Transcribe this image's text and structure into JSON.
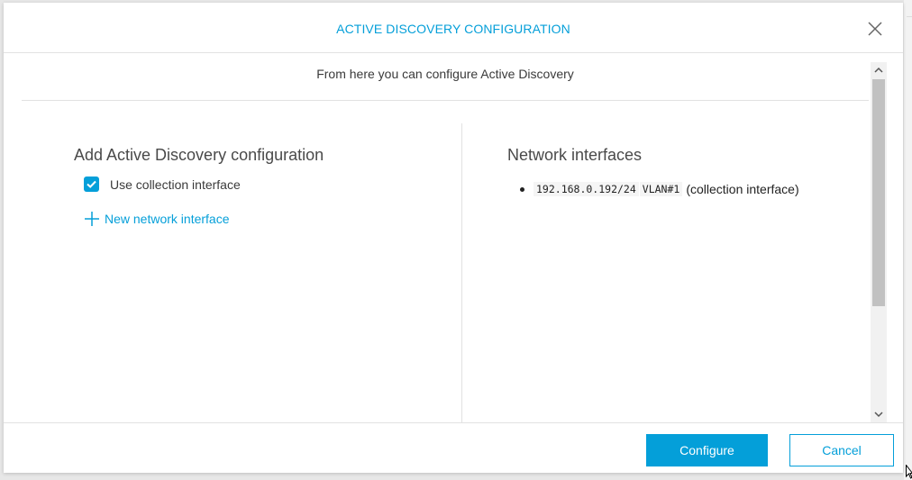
{
  "modal": {
    "title": "ACTIVE DISCOVERY CONFIGURATION",
    "subtitle": "From here you can configure Active Discovery"
  },
  "left": {
    "section_title": "Add Active Discovery configuration",
    "checkbox_label": "Use collection interface",
    "checkbox_checked": true,
    "add_link": "New network interface"
  },
  "right": {
    "section_title": "Network interfaces",
    "interfaces": [
      {
        "address": "192.168.0.192/24",
        "vlan": "VLAN#1",
        "note": "(collection interface)"
      }
    ]
  },
  "footer": {
    "configure_label": "Configure",
    "cancel_label": "Cancel"
  },
  "colors": {
    "accent": "#049fd9",
    "text": "#3a3a3a"
  },
  "icons": {
    "close": "close-icon",
    "checkbox": "checkmark-icon",
    "add": "plus-icon",
    "scroll_up": "chevron-up-icon",
    "scroll_down": "chevron-down-icon"
  }
}
